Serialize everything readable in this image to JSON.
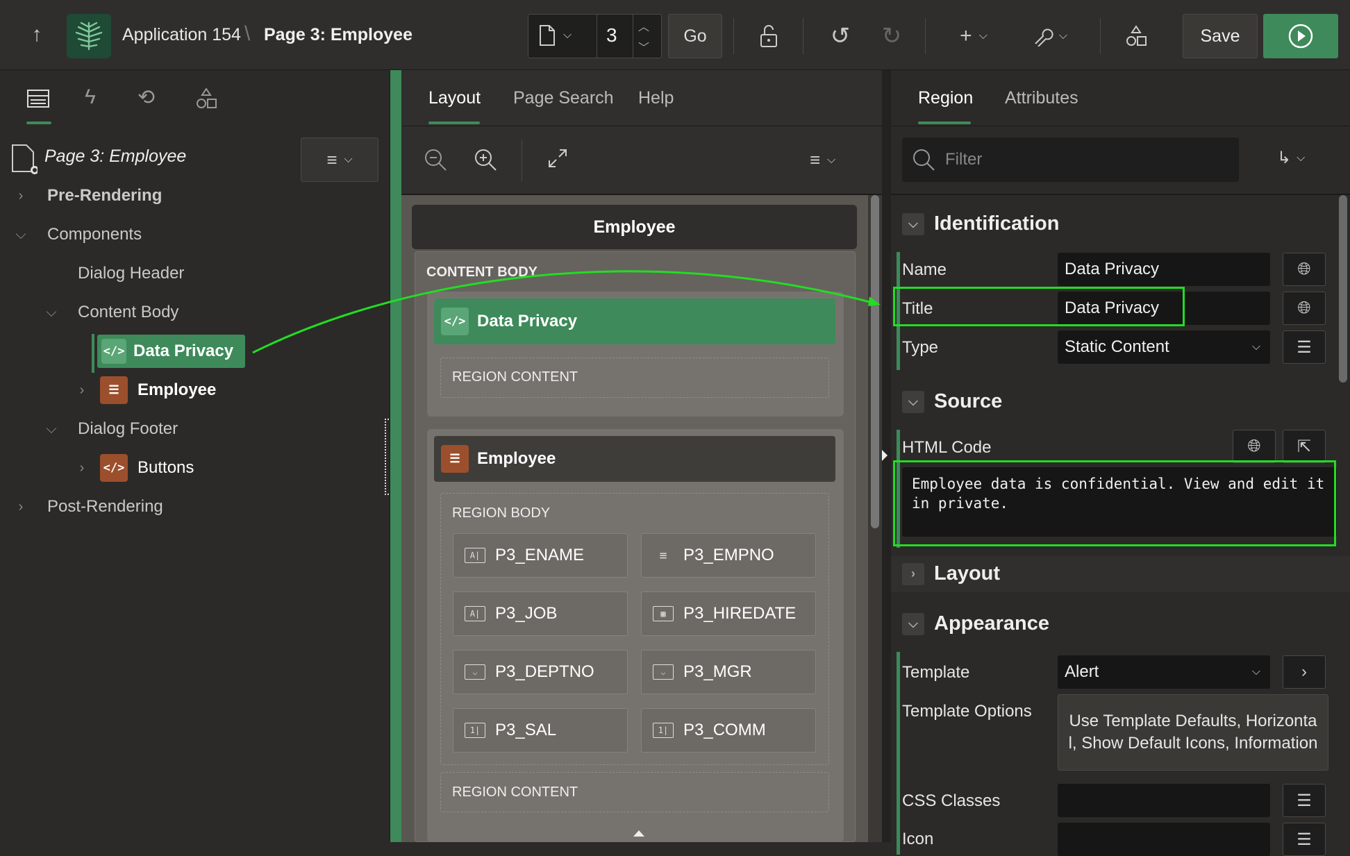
{
  "toolbar": {
    "app_name": "Application 154",
    "separator": "\\",
    "page_name": "Page 3: Employee",
    "page_number": "3",
    "go_label": "Go",
    "save_label": "Save"
  },
  "left": {
    "root_label": "Page 3: Employee",
    "tree": {
      "pre_rendering": "Pre-Rendering",
      "components": "Components",
      "dialog_header": "Dialog Header",
      "content_body": "Content Body",
      "data_privacy": "Data Privacy",
      "employee": "Employee",
      "dialog_footer": "Dialog Footer",
      "buttons": "Buttons",
      "post_rendering": "Post-Rendering"
    }
  },
  "middle": {
    "tabs": [
      "Layout",
      "Page Search",
      "Help"
    ],
    "page_title": "Employee",
    "content_body_label": "CONTENT BODY",
    "data_privacy_region": "Data Privacy",
    "region_content": "REGION CONTENT",
    "employee_region": "Employee",
    "region_body": "REGION BODY",
    "items": [
      "P3_ENAME",
      "P3_EMPNO",
      "P3_JOB",
      "P3_HIREDATE",
      "P3_DEPTNO",
      "P3_MGR",
      "P3_SAL",
      "P3_COMM"
    ],
    "region_content_2": "REGION CONTENT"
  },
  "right": {
    "tabs": [
      "Region",
      "Attributes"
    ],
    "filter_placeholder": "Filter",
    "identification": "Identification",
    "name_label": "Name",
    "name_value": "Data Privacy",
    "title_label": "Title",
    "title_value": "Data Privacy",
    "type_label": "Type",
    "type_value": "Static Content",
    "source": "Source",
    "html_code_label": "HTML Code",
    "html_code_value": "Employee data is confidential. View and edit it in private.",
    "layout": "Layout",
    "appearance": "Appearance",
    "template_label": "Template",
    "template_value": "Alert",
    "template_options_label": "Template Options",
    "template_options_value": "Use Template Defaults, Horizontal, Show Default Icons, Information",
    "css_classes_label": "CSS Classes",
    "icon_label": "Icon"
  },
  "colors": {
    "accent_green": "#3e8a5a",
    "highlight_green": "#22dd22",
    "region_icon_orange": "#a0522d"
  }
}
